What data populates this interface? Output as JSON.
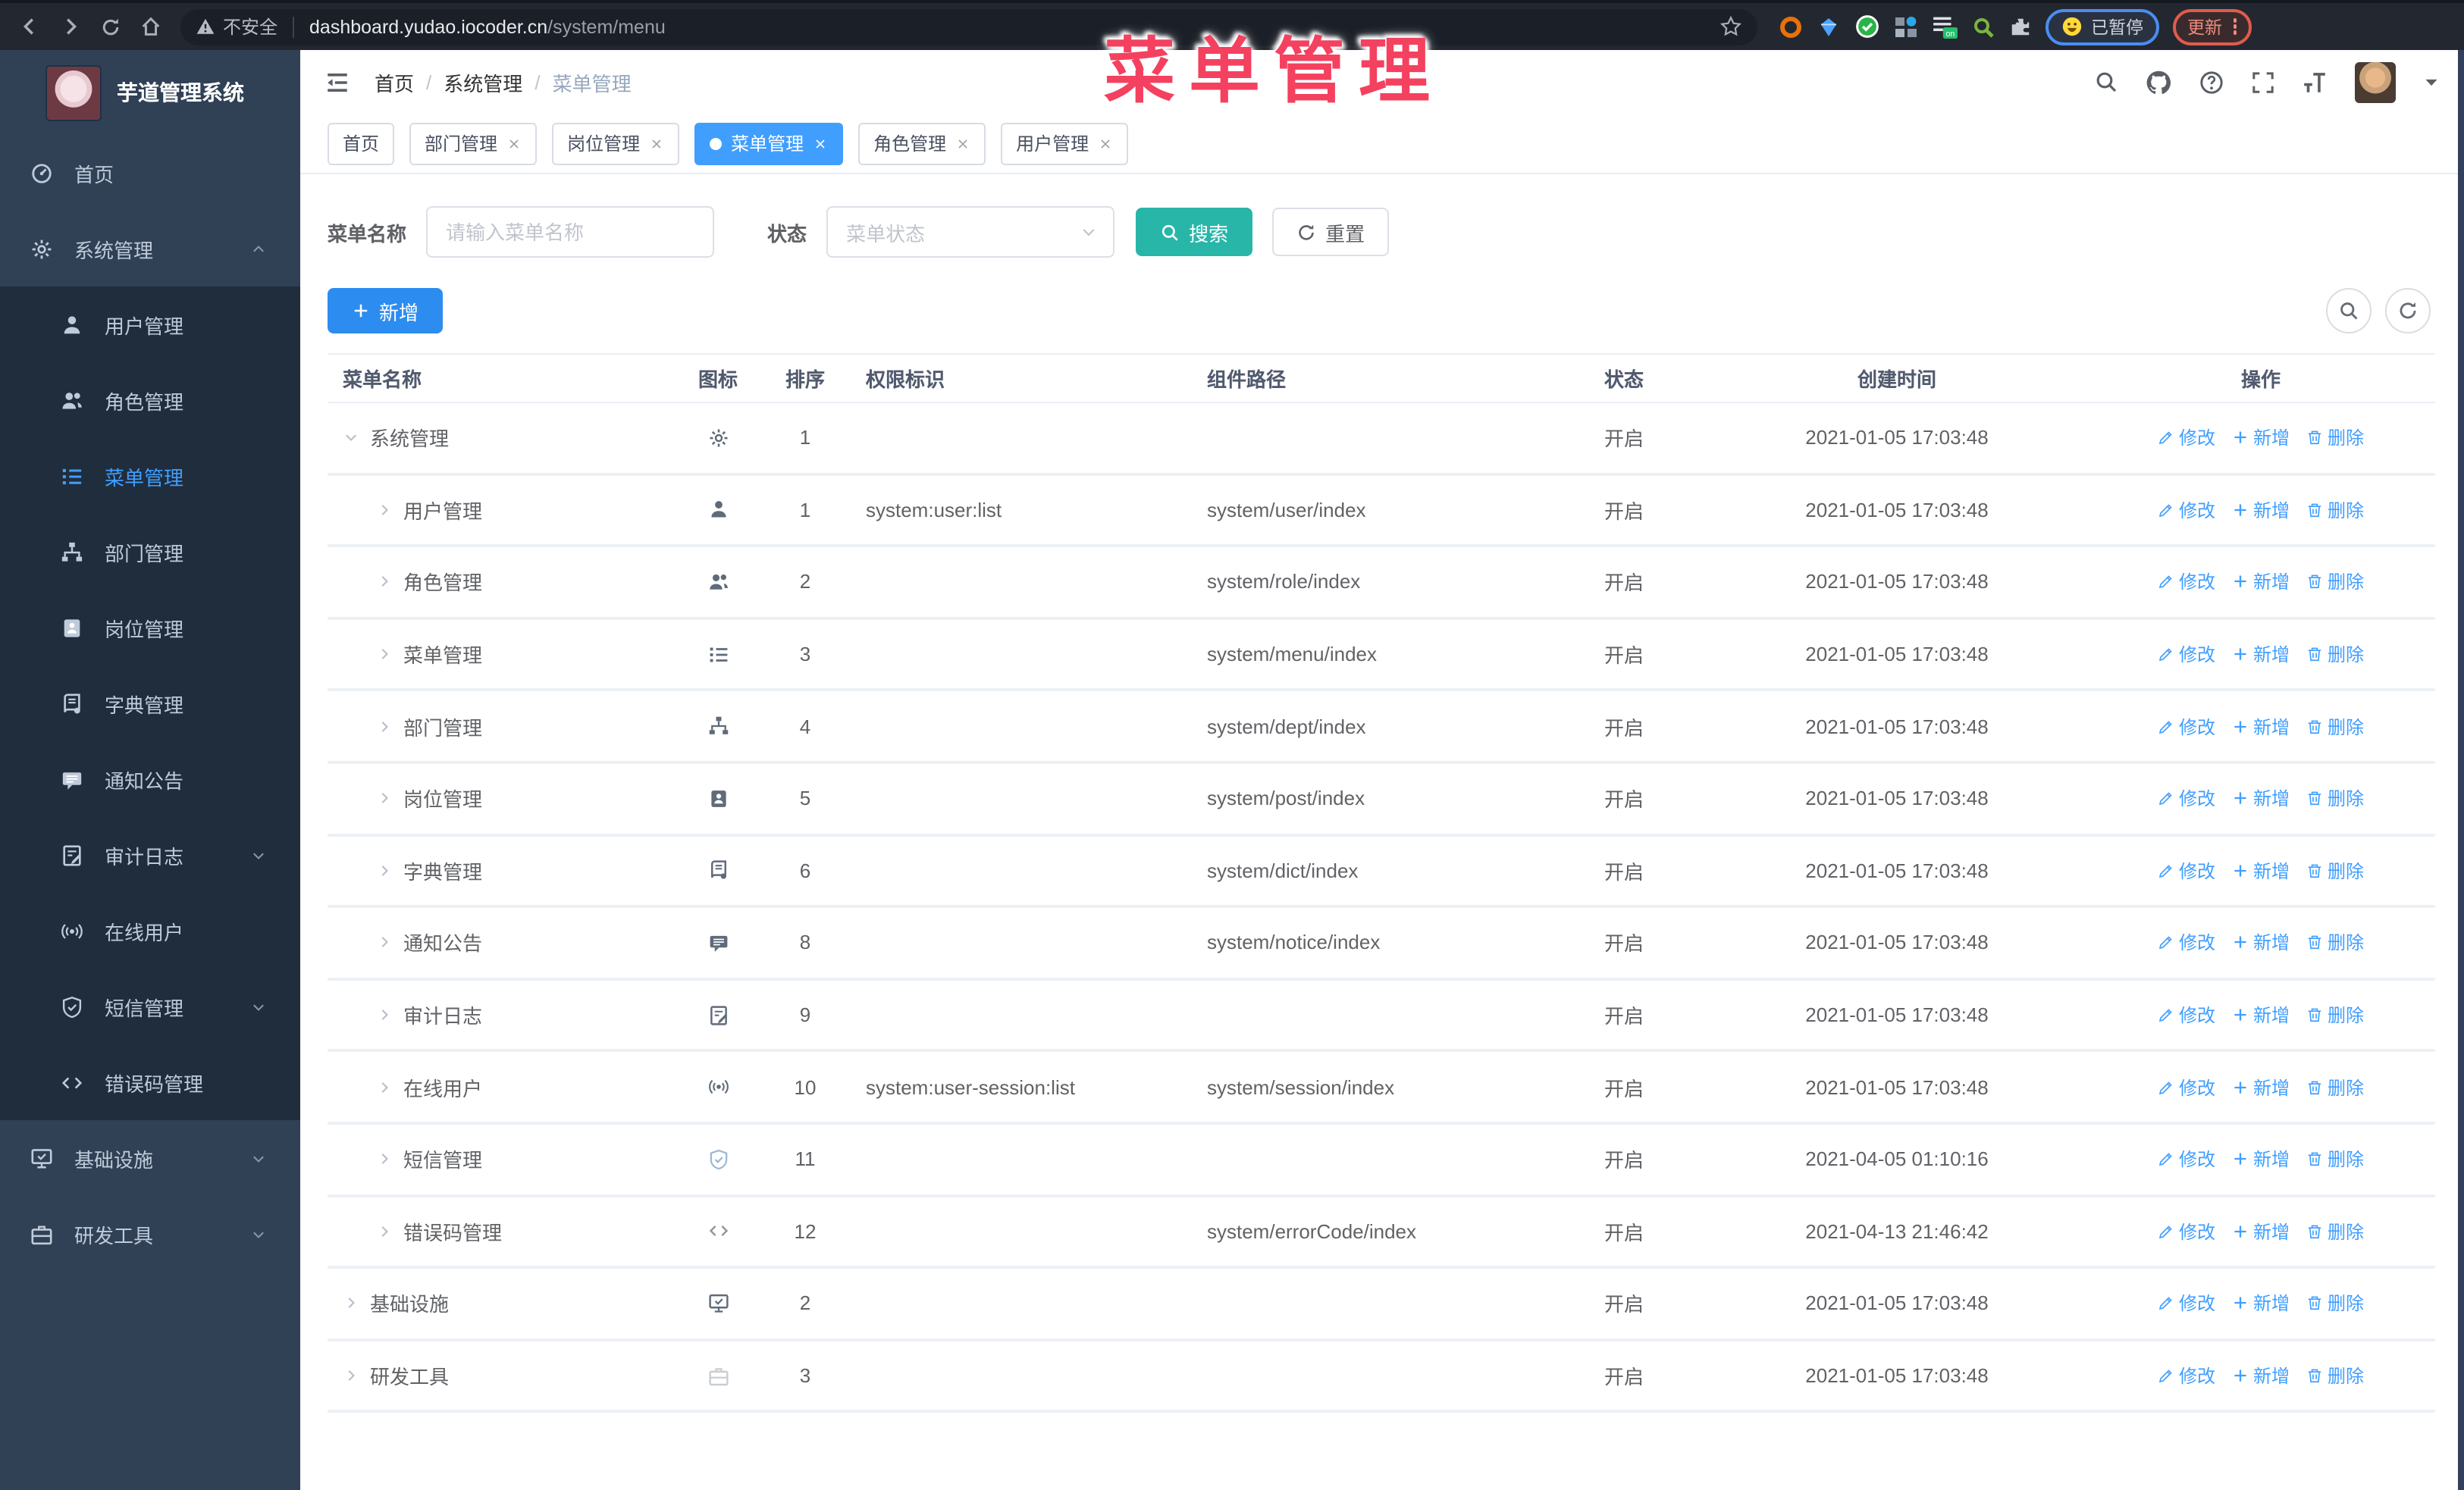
{
  "browser": {
    "security_text": "不安全",
    "url_host": "dashboard.yudao.iocoder.cn",
    "url_path": "/system/menu",
    "paused_label": "已暂停",
    "update_label": "更新"
  },
  "annotation": {
    "text": "菜单管理",
    "color": "#f4415f"
  },
  "sidebar": {
    "logo_title": "芋道管理系统",
    "menu": [
      {
        "label": "首页",
        "icon": "dashboard",
        "type": "root"
      },
      {
        "label": "系统管理",
        "icon": "gear",
        "type": "root",
        "arrow": "up"
      },
      {
        "label": "用户管理",
        "icon": "user",
        "type": "sub"
      },
      {
        "label": "角色管理",
        "icon": "users",
        "type": "sub"
      },
      {
        "label": "菜单管理",
        "icon": "menu-tree",
        "type": "sub",
        "active": true
      },
      {
        "label": "部门管理",
        "icon": "org-tree",
        "type": "sub"
      },
      {
        "label": "岗位管理",
        "icon": "badge",
        "type": "sub"
      },
      {
        "label": "字典管理",
        "icon": "dictionary",
        "type": "sub"
      },
      {
        "label": "通知公告",
        "icon": "announcement",
        "type": "sub"
      },
      {
        "label": "审计日志",
        "icon": "audit-log",
        "type": "sub",
        "arrow": "down"
      },
      {
        "label": "在线用户",
        "icon": "online-user",
        "type": "sub"
      },
      {
        "label": "短信管理",
        "icon": "sms",
        "type": "sub",
        "arrow": "down"
      },
      {
        "label": "错误码管理",
        "icon": "error-code",
        "type": "sub"
      },
      {
        "label": "基础设施",
        "icon": "infrastructure",
        "type": "root",
        "arrow": "down"
      },
      {
        "label": "研发工具",
        "icon": "dev-tools",
        "type": "root",
        "arrow": "down"
      }
    ]
  },
  "breadcrumb": [
    "首页",
    "系统管理",
    "菜单管理"
  ],
  "tabs": [
    {
      "label": "首页",
      "closable": false,
      "active": false
    },
    {
      "label": "部门管理",
      "closable": true,
      "active": false
    },
    {
      "label": "岗位管理",
      "closable": true,
      "active": false
    },
    {
      "label": "菜单管理",
      "closable": true,
      "active": true
    },
    {
      "label": "角色管理",
      "closable": true,
      "active": false
    },
    {
      "label": "用户管理",
      "closable": true,
      "active": false
    }
  ],
  "filters": {
    "name_label": "菜单名称",
    "name_placeholder": "请输入菜单名称",
    "status_label": "状态",
    "status_placeholder": "菜单状态",
    "search_label": "搜索",
    "reset_label": "重置"
  },
  "toolbar": {
    "add_label": "新增"
  },
  "table": {
    "columns": [
      "菜单名称",
      "图标",
      "排序",
      "权限标识",
      "组件路径",
      "状态",
      "创建时间",
      "操作"
    ],
    "actions": [
      "修改",
      "新增",
      "删除"
    ],
    "rows": [
      {
        "name": "系统管理",
        "icon": "gear",
        "level": 0,
        "expanded": true,
        "sort": "1",
        "perm": "",
        "path": "",
        "status": "开启",
        "time": "2021-01-05 17:03:48"
      },
      {
        "name": "用户管理",
        "icon": "user",
        "level": 1,
        "expanded": false,
        "sort": "1",
        "perm": "system:user:list",
        "path": "system/user/index",
        "status": "开启",
        "time": "2021-01-05 17:03:48"
      },
      {
        "name": "角色管理",
        "icon": "users",
        "level": 1,
        "expanded": false,
        "sort": "2",
        "perm": "",
        "path": "system/role/index",
        "status": "开启",
        "time": "2021-01-05 17:03:48"
      },
      {
        "name": "菜单管理",
        "icon": "menu-tree",
        "level": 1,
        "expanded": false,
        "sort": "3",
        "perm": "",
        "path": "system/menu/index",
        "status": "开启",
        "time": "2021-01-05 17:03:48"
      },
      {
        "name": "部门管理",
        "icon": "org-tree",
        "level": 1,
        "expanded": false,
        "sort": "4",
        "perm": "",
        "path": "system/dept/index",
        "status": "开启",
        "time": "2021-01-05 17:03:48"
      },
      {
        "name": "岗位管理",
        "icon": "badge",
        "level": 1,
        "expanded": false,
        "sort": "5",
        "perm": "",
        "path": "system/post/index",
        "status": "开启",
        "time": "2021-01-05 17:03:48"
      },
      {
        "name": "字典管理",
        "icon": "dictionary",
        "level": 1,
        "expanded": false,
        "sort": "6",
        "perm": "",
        "path": "system/dict/index",
        "status": "开启",
        "time": "2021-01-05 17:03:48"
      },
      {
        "name": "通知公告",
        "icon": "announcement",
        "level": 1,
        "expanded": false,
        "sort": "8",
        "perm": "",
        "path": "system/notice/index",
        "status": "开启",
        "time": "2021-01-05 17:03:48"
      },
      {
        "name": "审计日志",
        "icon": "audit-log",
        "level": 1,
        "expanded": false,
        "sort": "9",
        "perm": "",
        "path": "",
        "status": "开启",
        "time": "2021-01-05 17:03:48"
      },
      {
        "name": "在线用户",
        "icon": "online-user",
        "level": 1,
        "expanded": false,
        "sort": "10",
        "perm": "system:user-session:list",
        "path": "system/session/index",
        "status": "开启",
        "time": "2021-01-05 17:03:48"
      },
      {
        "name": "短信管理",
        "icon": "sms",
        "level": 1,
        "expanded": false,
        "sort": "11",
        "perm": "",
        "path": "",
        "status": "开启",
        "time": "2021-04-05 01:10:16"
      },
      {
        "name": "错误码管理",
        "icon": "error-code",
        "level": 1,
        "expanded": false,
        "sort": "12",
        "perm": "",
        "path": "system/errorCode/index",
        "status": "开启",
        "time": "2021-04-13 21:46:42"
      },
      {
        "name": "基础设施",
        "icon": "infrastructure",
        "level": 0,
        "expanded": false,
        "sort": "2",
        "perm": "",
        "path": "",
        "status": "开启",
        "time": "2021-01-05 17:03:48"
      },
      {
        "name": "研发工具",
        "icon": "dev-tools",
        "level": 0,
        "expanded": false,
        "sort": "3",
        "perm": "",
        "path": "",
        "status": "开启",
        "time": "2021-01-05 17:03:48"
      }
    ]
  },
  "colors": {
    "accent_blue": "#409EFF",
    "search_teal": "#28b6a8",
    "add_blue": "#2d8cf0",
    "sidebar_bg": "#304156",
    "submenu_bg": "#1f2d3d",
    "annotation_pink": "#f4415f"
  }
}
